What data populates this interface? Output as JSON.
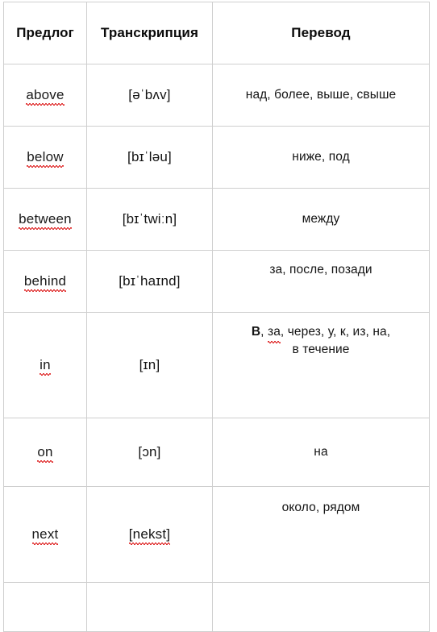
{
  "table": {
    "headers": {
      "preposition": "Предлог",
      "transcription": "Транскрипция",
      "translation": "Перевод"
    },
    "rows": [
      {
        "preposition": "above",
        "transcription": "[əˈbʌv]",
        "translation": "над, более, выше, свыше",
        "misspelled_preposition": true
      },
      {
        "preposition": "below",
        "transcription": "[bɪˈləu]",
        "translation": "ниже, под",
        "misspelled_preposition": true
      },
      {
        "preposition": "between",
        "transcription": "[bɪˈtwiːn]",
        "translation": "между",
        "misspelled_preposition": true
      },
      {
        "preposition": "behind",
        "transcription": "[bɪˈhaɪnd]",
        "translation": "за, после, позади",
        "misspelled_preposition": true
      },
      {
        "preposition": "in",
        "transcription": "[ɪn]",
        "translation_bold_lead": "В",
        "translation_rest_a": ", ",
        "translation_flagged": "за",
        "translation_rest_b": ", через, у, к, из, на,",
        "translation_line2": "в течение",
        "misspelled_preposition": true
      },
      {
        "preposition": "on",
        "transcription": "[ɔn]",
        "translation": "на",
        "misspelled_preposition": true
      },
      {
        "preposition": "next",
        "transcription": "[nekst]",
        "translation": "около, рядом",
        "misspelled_preposition": true
      }
    ]
  },
  "colors": {
    "border": "#cfcfcf",
    "text": "#141414",
    "spellcheck_underline": "#e03131",
    "background": "#ffffff"
  }
}
